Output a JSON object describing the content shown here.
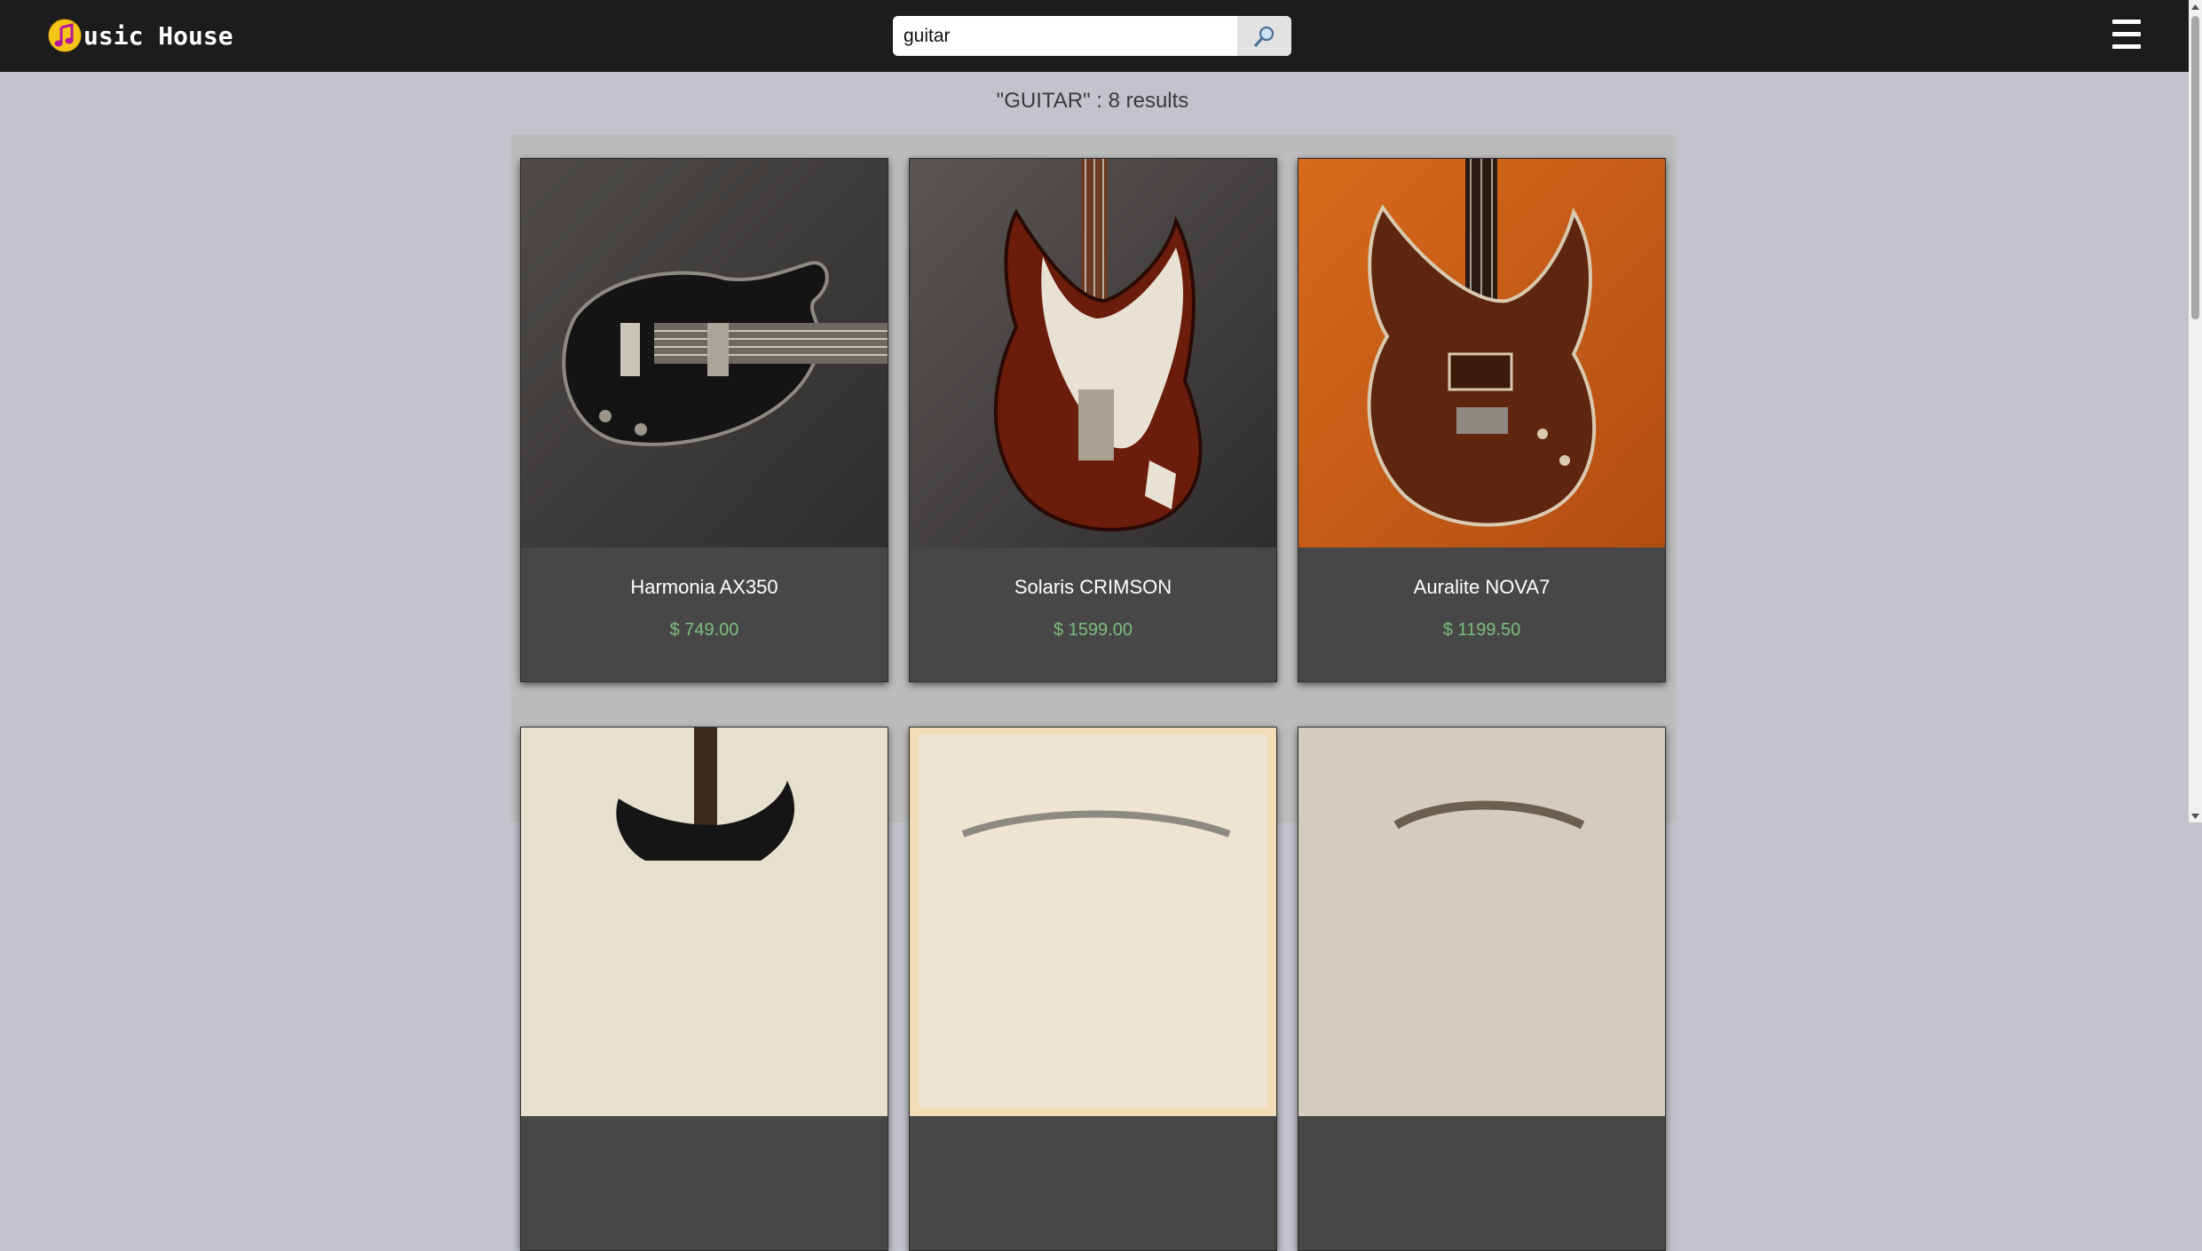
{
  "app": {
    "title": "usic House"
  },
  "search": {
    "value": "guitar",
    "button": "search-icon"
  },
  "menu": {
    "icon": "hamburger-menu-icon"
  },
  "results": {
    "heading": "\"GUITAR\" : 8 results"
  },
  "products": [
    {
      "name": "Harmonia AX350",
      "price": "$ 749.00"
    },
    {
      "name": "Solaris CRIMSON",
      "price": "$ 1599.00"
    },
    {
      "name": "Auralite NOVA7",
      "price": "$ 1199.50"
    }
  ],
  "colors": {
    "header_bg": "#1d1c1d",
    "page_bg": "#c2c3cb",
    "card_bg": "#474747",
    "price_green": "#7dbd7f",
    "logo_yellow": "#f5c518",
    "logo_magenta": "#b5179e"
  }
}
